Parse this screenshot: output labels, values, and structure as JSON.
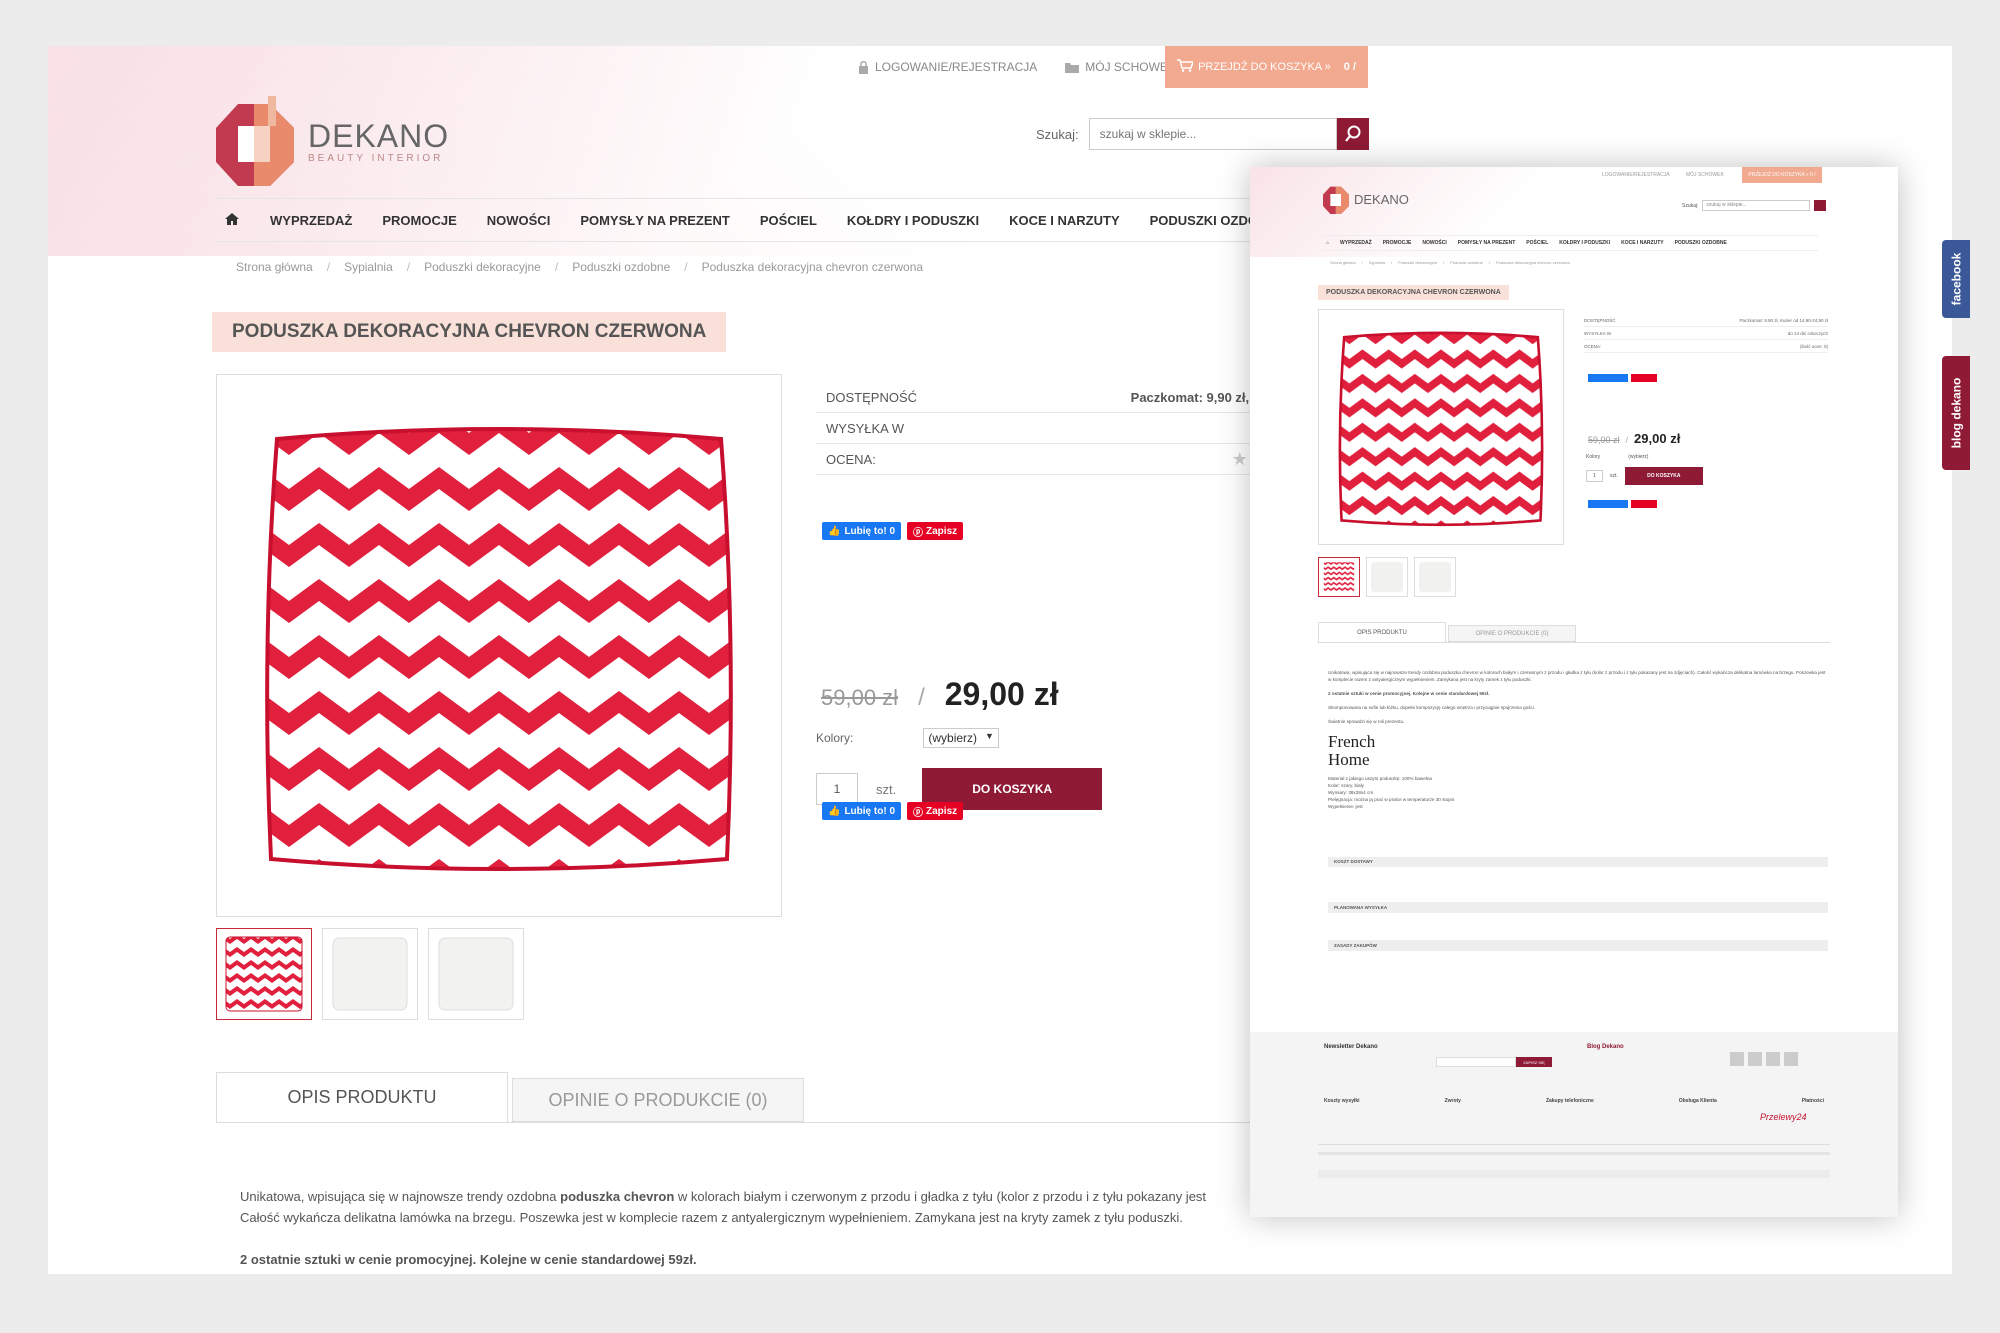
{
  "topbar": {
    "login": "LOGOWANIE/REJESTRACJA",
    "wishlist": "MÓJ SCHOWEK",
    "cart": "PRZEJDŹ DO KOSZYKA »",
    "cart_amount": "0 /"
  },
  "logo": {
    "name": "DEKANO",
    "sub": "BEAUTY INTERIOR"
  },
  "search": {
    "label": "Szukaj:",
    "placeholder": "szukaj w sklepie..."
  },
  "nav": [
    "WYPRZEDAŻ",
    "PROMOCJE",
    "NOWOŚCI",
    "POMYSŁY NA PREZENT",
    "POŚCIEL",
    "KOŁDRY I PODUSZKI",
    "KOCE I NARZUTY",
    "PODUSZKI OZDOBNE"
  ],
  "breadcrumb": [
    "Strona główna",
    "Sypialnia",
    "Poduszki dekoracyjne",
    "Poduszki ozdobne",
    "Poduszka dekoracyjna chevron czerwona"
  ],
  "product": {
    "title": "PODUSZKA DEKORACYJNA CHEVRON CZERWONA",
    "availability_label": "DOSTĘPNOŚĆ",
    "availability_value": "Paczkomat: 9,90 zł, Kurie",
    "shipping_label": "WYSYŁKA W",
    "shipping_value": "d",
    "rating_label": "OCENA:",
    "old_price": "59,00 zł",
    "slash": "/",
    "price": "29,00 zł",
    "colors_label": "Kolory:",
    "colors_value": "(wybierz)",
    "qty": "1",
    "unit": "szt.",
    "add_to_cart": "DO KOSZYKA"
  },
  "social": {
    "like": "Lubię to! 0",
    "save": "Zapisz"
  },
  "tabs": [
    "OPIS PRODUKTU",
    "OPINIE O PRODUKCIE (0)"
  ],
  "description": {
    "line1_pre": "Unikatowa, wpisująca się w najnowsze trendy ozdobna ",
    "line1_bold": "poduszka chevron",
    "line1_post": " w kolorach białym i czerwonym z przodu i gładka z tyłu (kolor z przodu i z tyłu pokazany jest",
    "line2": "Całość wykańcza delikatna lamówka na brzegu. Poszewka jest w komplecie razem z antyalergicznym wypełnieniem. Zamykana jest na kryty zamek z tyłu poduszki.",
    "promo": "2 ostatnie sztuki w cenie promocyjnej. Kolejne w cenie standardowej 59zł."
  },
  "sidebar": {
    "facebook": "facebook",
    "blog": "blog dekano"
  },
  "mini": {
    "login": "LOGOWANIE/REJESTRACJA",
    "wishlist": "MÓJ SCHOWEK",
    "cart": "PRZEJDŹ DO KOSZYKA » 0 /",
    "search_label": "Szukaj:",
    "search_placeholder": "szukaj w sklepie...",
    "title": "PODUSZKA DEKORACYJNA CHEVRON CZERWONA",
    "availability_value": "Paczkomat: 9,90 zł, Kurier od 14,90-24,90 zł",
    "shipping_value": "do 14 dni roboczych",
    "rating_value": "(ilość ocen: 0)",
    "old_price": "59,00 zł",
    "price": "29,00 zł",
    "colors_label": "Kolory",
    "colors_value": "(wybierz)",
    "qty": "1",
    "unit": "szt.",
    "add_to_cart": "DO KOSZYKA",
    "tab1": "OPIS PRODUKTU",
    "tab2": "OPINIE O PRODUKCIE (0)",
    "desc": "Unikatowa, wpisująca się w najnowsze trendy ozdobna poduszka chevron w kolorach białym i czerwonym z przodu i gładka z tyłu (kolor z przodu i z tyłu pokazany jest na zdjęciach). Całość wykańcza delikatna lamówka na brzegu. Poszewka jest w komplecie razem z antyalergicznym wypełnieniem. Zamykana jest na kryty zamek z tyłu poduszki.",
    "promo": "2 ostatnie sztuki w cenie promocyjnej. Kolejne w cenie standardowej 59zł.",
    "desc2": "Skomponowana na sofie lub łóżku, dopełni kompozycję całego wnętrza i przyciągnie spojrzenia gości.",
    "desc3": "Świetnie sprawdzi się w roli prezentu.",
    "brand": "French Home",
    "spec1": "Materiał z jakiego uszyto poduszkę: 100% bawełna",
    "spec2": "Kolor: szary, biały",
    "spec3": "Wymiary: 38x38x4 cm",
    "spec4": "Pielęgnacja: można ją prać w pralce w temperaturze 30 stopni",
    "spec5": "Wypełnienie: jest",
    "h_koszt": "KOSZT DOSTAWY",
    "h_wysylka": "PLANOWANA WYSYŁKA",
    "h_zasady": "ZASADY ZAKUPÓW",
    "newsletter_title": "Newsletter Dekano",
    "newsletter_btn": "ZAPISZ SIĘ",
    "blog_title": "Blog Dekano",
    "f1": "Koszty wysyłki",
    "f2": "Zwroty",
    "f3": "Zakupy telefoniczne",
    "f4": "Obsługa Klienta",
    "f5": "Płatności",
    "przelewy": "Przelewy24"
  },
  "colors": {
    "accent": "#8f1a35",
    "cart": "#f1a98f",
    "title_bg": "#f9e1d9",
    "chevron": "#e0203c"
  }
}
